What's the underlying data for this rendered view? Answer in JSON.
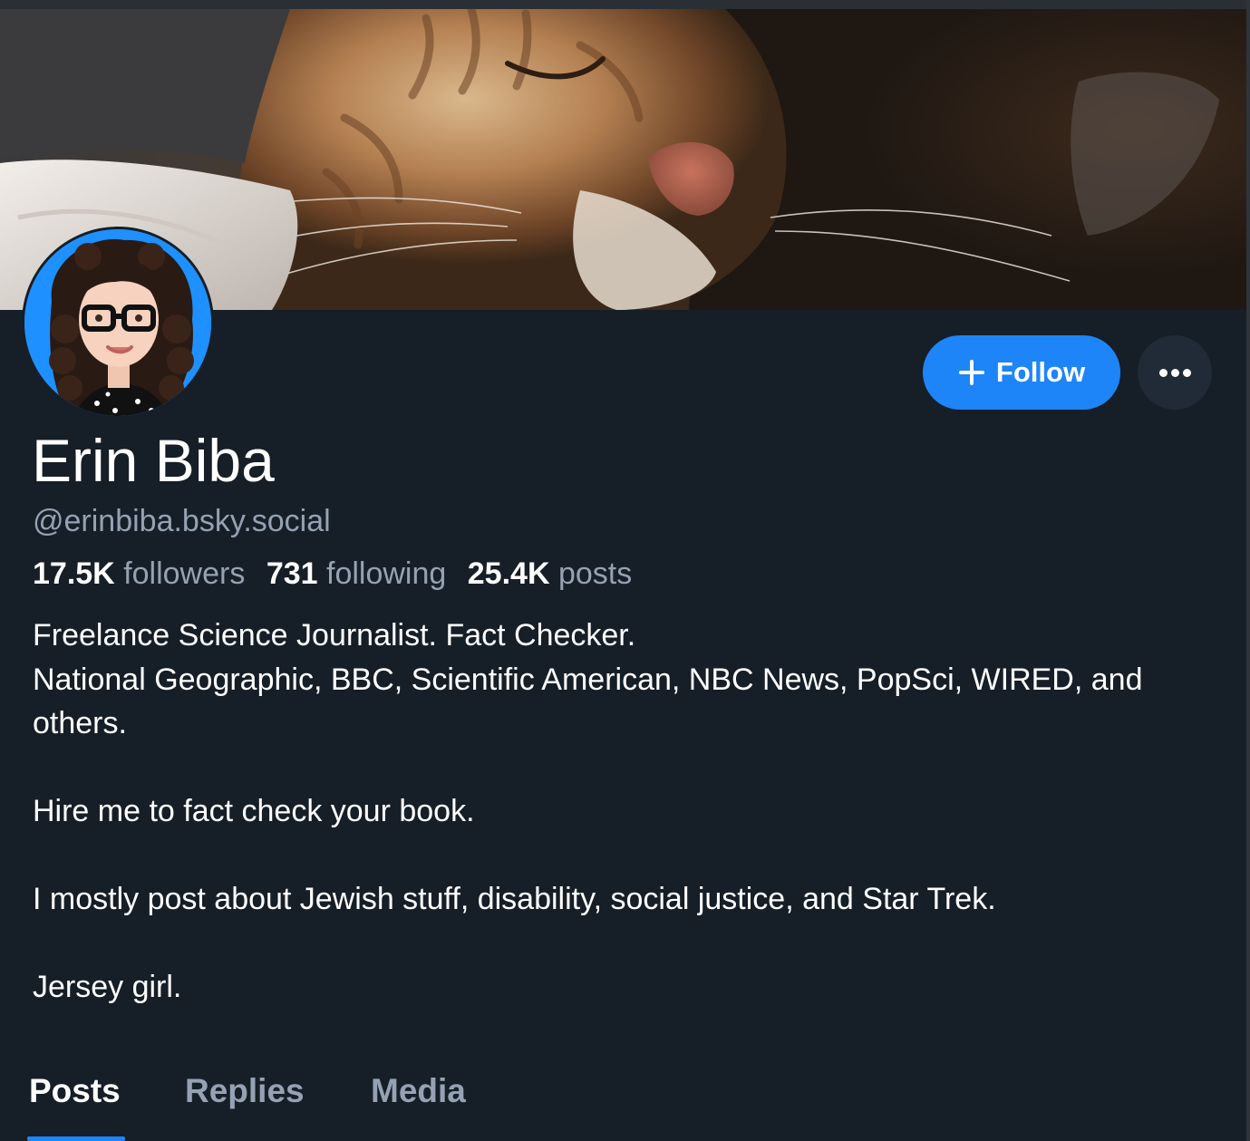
{
  "profile": {
    "display_name": "Erin Biba",
    "handle": "@erinbiba.bsky.social",
    "stats": {
      "followers_count": "17.5K",
      "followers_label": "followers",
      "following_count": "731",
      "following_label": "following",
      "posts_count": "25.4K",
      "posts_label": "posts"
    },
    "bio": {
      "line1": "Freelance Science Journalist. Fact Checker.",
      "line2": "National Geographic, BBC, Scientific American, NBC News, PopSci, WIRED, and others.",
      "line3": "Hire me to fact check your book.",
      "line4": "I mostly post about Jewish stuff, disability, social justice, and Star Trek.",
      "line5": "Jersey girl."
    }
  },
  "actions": {
    "follow_label": "Follow",
    "follow_icon": "plus-icon",
    "more_icon": "ellipsis-icon"
  },
  "tabs": [
    {
      "label": "Posts",
      "active": true
    },
    {
      "label": "Replies",
      "active": false
    },
    {
      "label": "Media",
      "active": false
    }
  ],
  "colors": {
    "background": "#161e27",
    "accent": "#1d85f7",
    "muted_text": "#94a2b3",
    "avatar_background": "#1e90ff"
  }
}
